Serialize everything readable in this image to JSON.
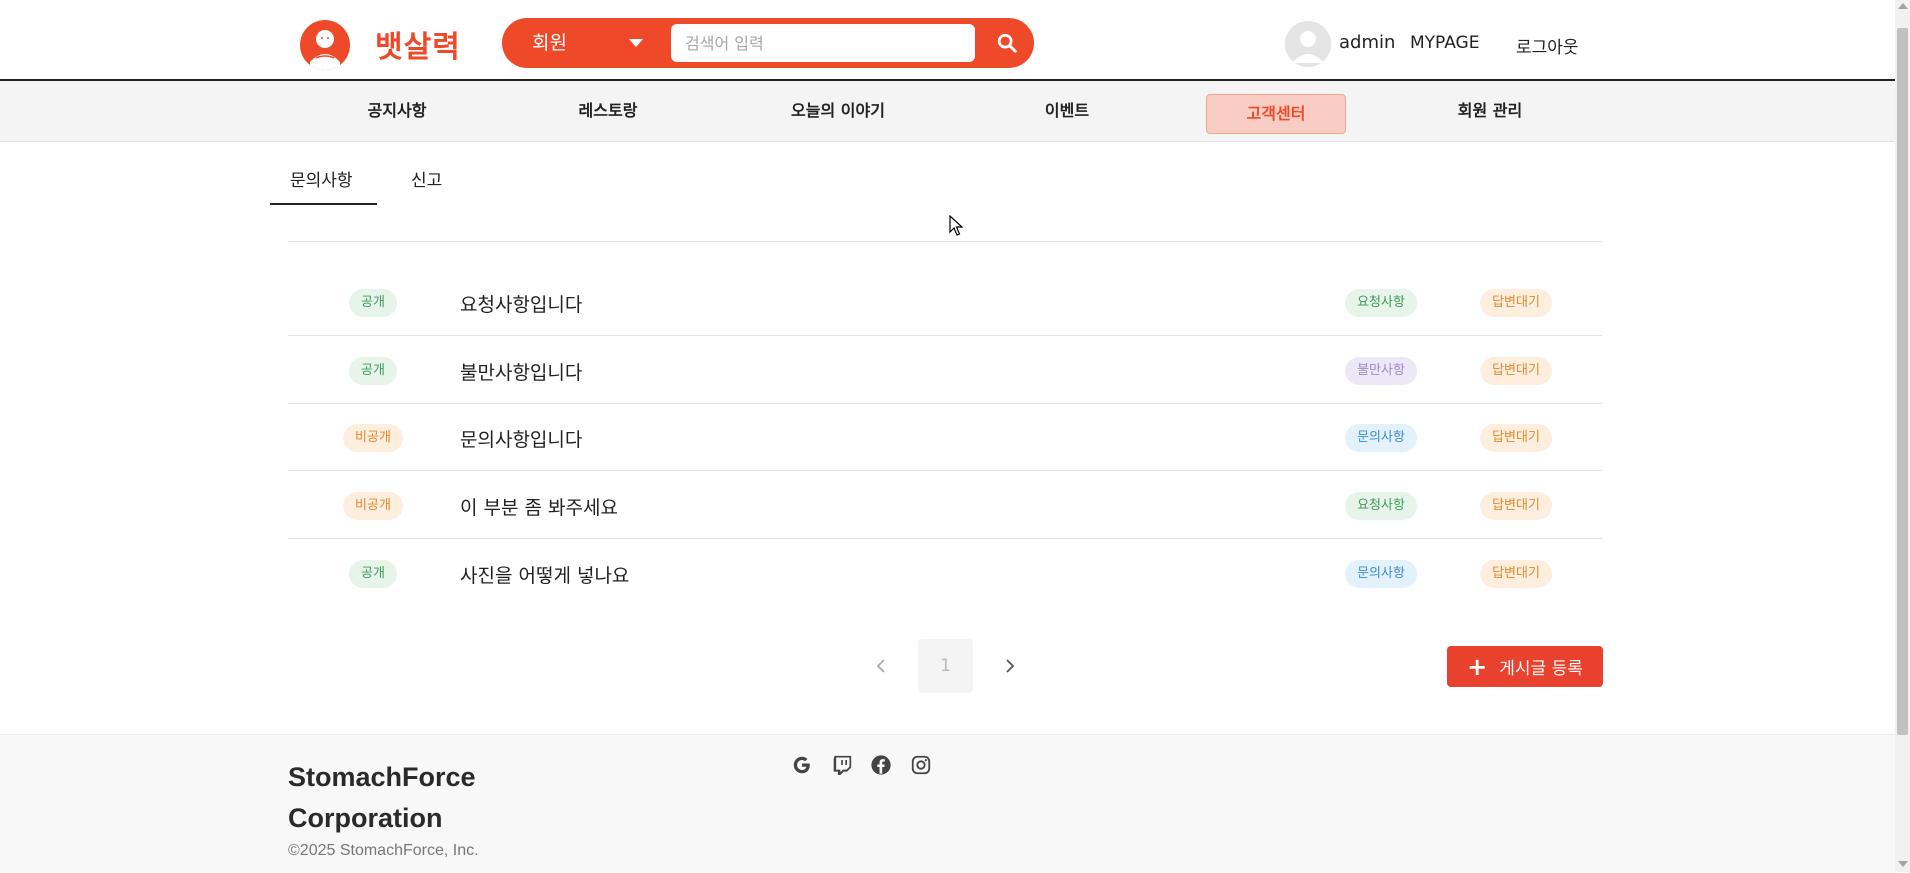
{
  "header": {
    "brand": "뱃살력",
    "search": {
      "category": "회원",
      "placeholder": "검색어 입력"
    },
    "user": {
      "name": "admin",
      "mypage_label": "MYPAGE",
      "logout_label": "로그아웃"
    }
  },
  "nav": {
    "items": [
      {
        "label": "공지사항"
      },
      {
        "label": "레스토랑"
      },
      {
        "label": "오늘의 이야기"
      },
      {
        "label": "이벤트"
      },
      {
        "label": "고객센터",
        "active": true
      },
      {
        "label": "회원 관리"
      }
    ]
  },
  "tabs": [
    {
      "label": "문의사항",
      "active": true
    },
    {
      "label": "신고"
    }
  ],
  "posts": [
    {
      "visibility": "공개",
      "title": "요청사항입니다",
      "type": "요청사항",
      "status": "답변대기"
    },
    {
      "visibility": "공개",
      "title": "불만사항입니다",
      "type": "불만사항",
      "status": "답변대기"
    },
    {
      "visibility": "비공개",
      "title": "문의사항입니다",
      "type": "문의사항",
      "status": "답변대기"
    },
    {
      "visibility": "비공개",
      "title": "이 부분 좀 봐주세요",
      "type": "요청사항",
      "status": "답변대기"
    },
    {
      "visibility": "공개",
      "title": "사진을 어떻게 넣나요",
      "type": "문의사항",
      "status": "답변대기"
    }
  ],
  "pagination": {
    "current": "1"
  },
  "write_button": {
    "label": "게시글 등록"
  },
  "footer": {
    "company_line1": "StomachForce",
    "company_line2": "Corporation",
    "copyright": "©2025 StomachForce, Inc.",
    "social_icons": [
      "google-icon",
      "twitch-icon",
      "facebook-icon",
      "instagram-icon"
    ]
  },
  "colors": {
    "brand": "#ee4a2a",
    "public_tag_bg": "#e6f4ea",
    "public_tag_fg": "#3d9a5b",
    "private_tag_bg": "#fdeede",
    "private_tag_fg": "#e08a2c",
    "request_bg": "#e6f4ea",
    "request_fg": "#3d9a5b",
    "complaint_bg": "#ede8f7",
    "complaint_fg": "#9b8ac6",
    "inquiry_bg": "#e3f1fb",
    "inquiry_fg": "#3a8fd0",
    "waiting_bg": "#fdeede",
    "waiting_fg": "#e08a2c"
  }
}
